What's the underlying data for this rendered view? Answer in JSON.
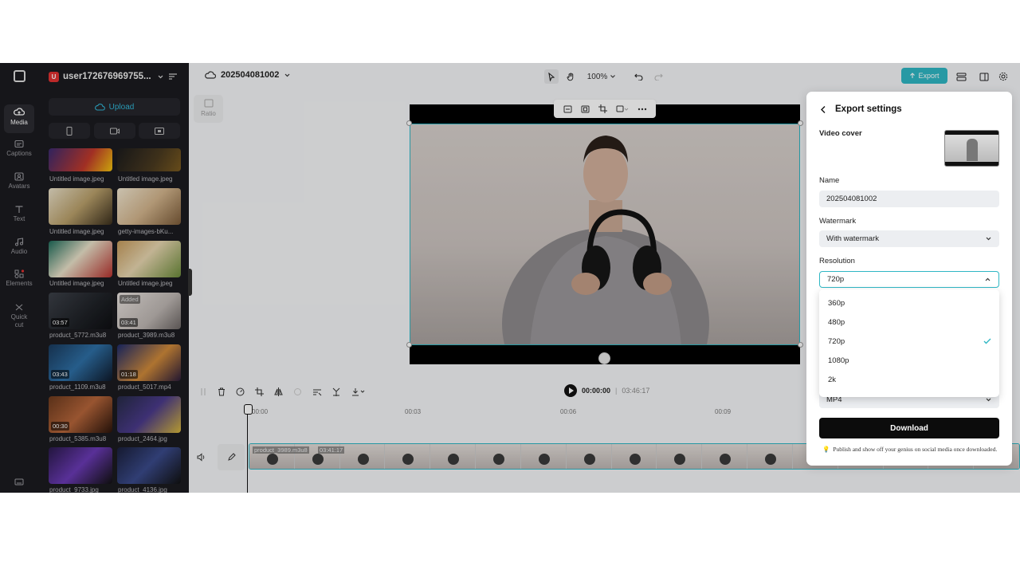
{
  "rail": {
    "items": [
      {
        "label": "Media",
        "icon": "cloud-icon"
      },
      {
        "label": "Captions",
        "icon": "captions-icon"
      },
      {
        "label": "Avatars",
        "icon": "avatar-icon"
      },
      {
        "label": "Text",
        "icon": "text-icon"
      },
      {
        "label": "Audio",
        "icon": "music-icon"
      },
      {
        "label": "Elements",
        "icon": "elements-icon"
      },
      {
        "label": "Quick cut",
        "icon": "quick-cut-icon"
      }
    ]
  },
  "panel": {
    "user_initial": "U",
    "user_name": "user172676969755...",
    "upload_label": "Upload",
    "media": [
      {
        "caption": "Untitled image.jpeg",
        "duration": "",
        "added": ""
      },
      {
        "caption": "Untitled image.jpeg",
        "duration": "",
        "added": ""
      },
      {
        "caption": "Untitled image.jpeg",
        "duration": "",
        "added": ""
      },
      {
        "caption": "getty-images-bKu...",
        "duration": "",
        "added": ""
      },
      {
        "caption": "Untitled image.jpeg",
        "duration": "",
        "added": ""
      },
      {
        "caption": "Untitled image.jpeg",
        "duration": "",
        "added": ""
      },
      {
        "caption": "product_5772.m3u8",
        "duration": "03:57",
        "added": ""
      },
      {
        "caption": "product_3989.m3u8",
        "duration": "03:41",
        "added": "Added"
      },
      {
        "caption": "product_1109.m3u8",
        "duration": "03:43",
        "added": ""
      },
      {
        "caption": "product_5017.mp4",
        "duration": "01:18",
        "added": ""
      },
      {
        "caption": "product_5385.m3u8",
        "duration": "00:30",
        "added": ""
      },
      {
        "caption": "product_2464.jpg",
        "duration": "",
        "added": ""
      },
      {
        "caption": "product_9733.jpg",
        "duration": "",
        "added": ""
      },
      {
        "caption": "product_4136.jpg",
        "duration": "",
        "added": ""
      }
    ]
  },
  "topbar": {
    "project_name": "202504081002",
    "zoom": "100%",
    "export_label": "Export"
  },
  "canvas": {
    "ratio_label": "Ratio"
  },
  "timeline": {
    "current_time": "00:00:00",
    "separator": "|",
    "total_time": "03:46:17",
    "ruler": [
      "00:00",
      "00:03",
      "00:06",
      "00:09"
    ],
    "clip_name": "product_3989.m3u8",
    "clip_duration": "03:41:17"
  },
  "export_panel": {
    "title": "Export settings",
    "video_cover_label": "Video cover",
    "name_label": "Name",
    "name_value": "202504081002",
    "watermark_label": "Watermark",
    "watermark_value": "With watermark",
    "resolution_label": "Resolution",
    "resolution_value": "720p",
    "format_value": "MP4",
    "download_label": "Download",
    "tip": "Publish and show off your genius on social media once downloaded."
  },
  "resolution_options": [
    {
      "label": "360p",
      "selected": false
    },
    {
      "label": "480p",
      "selected": false
    },
    {
      "label": "720p",
      "selected": true
    },
    {
      "label": "1080p",
      "selected": false
    },
    {
      "label": "2k",
      "selected": false
    }
  ],
  "colors": {
    "accent": "#2fb7c4",
    "sidebar": "#1b1b1f",
    "download": "#0c0c0c"
  }
}
